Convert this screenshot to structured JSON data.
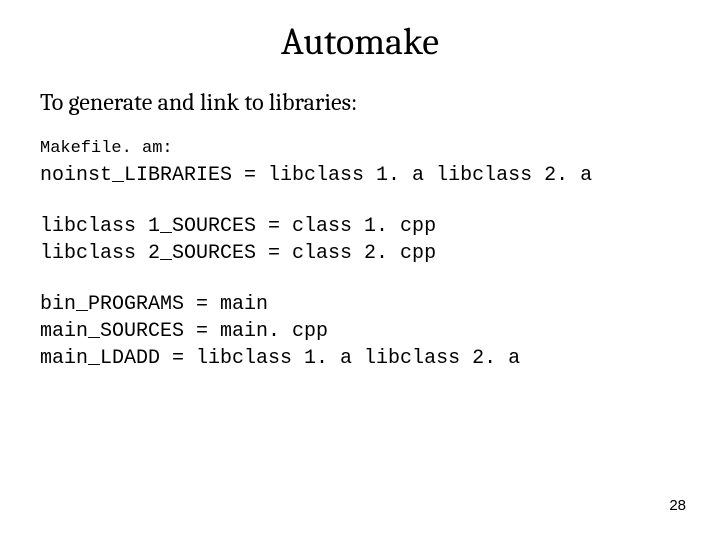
{
  "title": "Automake",
  "subtitle": "To generate and link to libraries:",
  "file_label": "Makefile. am:",
  "lines": {
    "noinst": "noinst_LIBRARIES = libclass 1. a libclass 2. a",
    "src1": "libclass 1_SOURCES = class 1. cpp",
    "src2": "libclass 2_SOURCES = class 2. cpp",
    "bin": "bin_PROGRAMS = main",
    "main_src": "main_SOURCES = main. cpp",
    "main_ld": "main_LDADD = libclass 1. a libclass 2. a"
  },
  "page_number": "28"
}
